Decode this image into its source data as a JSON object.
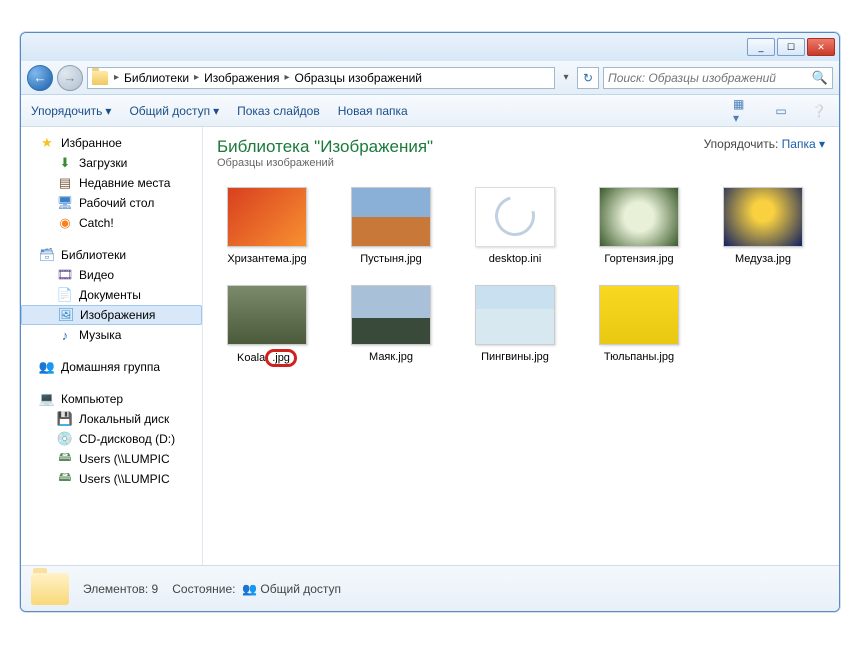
{
  "window": {
    "minimize": "_",
    "maximize": "☐",
    "close": "✕"
  },
  "breadcrumb": {
    "items": [
      "Библиотеки",
      "Изображения",
      "Образцы изображений"
    ]
  },
  "search": {
    "placeholder": "Поиск: Образцы изображений"
  },
  "toolbar": {
    "organize": "Упорядочить",
    "share": "Общий доступ",
    "slideshow": "Показ слайдов",
    "newfolder": "Новая папка"
  },
  "sidebar": {
    "favorites": {
      "label": "Избранное",
      "items": [
        "Загрузки",
        "Недавние места",
        "Рабочий стол",
        "Catch!"
      ]
    },
    "libraries": {
      "label": "Библиотеки",
      "items": [
        "Видео",
        "Документы",
        "Изображения",
        "Музыка"
      ]
    },
    "homegroup": {
      "label": "Домашняя группа"
    },
    "computer": {
      "label": "Компьютер",
      "items": [
        "Локальный диск",
        "CD-дисковод (D:)",
        "Users (\\\\LUMPIC",
        "Users (\\\\LUMPIC"
      ]
    }
  },
  "library_header": {
    "title": "Библиотека \"Изображения\"",
    "subtitle": "Образцы изображений",
    "arrange_label": "Упорядочить:",
    "arrange_value": "Папка"
  },
  "files": [
    {
      "name": "Хризантема.jpg",
      "thumb_bg": "linear-gradient(135deg,#d84020,#f89030)"
    },
    {
      "name": "Пустыня.jpg",
      "thumb_bg": "linear-gradient(#8ab0d8 50%,#c87838 50%)"
    },
    {
      "name": "desktop.ini",
      "thumb_bg": "#fff",
      "is_ini": true
    },
    {
      "name": "Гортензия.jpg",
      "thumb_bg": "radial-gradient(circle,#e8f0d8 30%,#3a5a2a)"
    },
    {
      "name": "Медуза.jpg",
      "thumb_bg": "radial-gradient(circle at 50% 40%,#f8d040 20%,#102060)"
    },
    {
      "name": "Koala.jpg",
      "thumb_bg": "linear-gradient(#7a8a6a,#4a5a3a)",
      "highlight_ext": true,
      "name_base": "Koala",
      "name_ext": ".jpg"
    },
    {
      "name": "Маяк.jpg",
      "thumb_bg": "linear-gradient(#a8c0d8 55%,#3a4a3a 55%)"
    },
    {
      "name": "Пингвины.jpg",
      "thumb_bg": "linear-gradient(#c8e0f0 40%,#d8e8f0 40%)"
    },
    {
      "name": "Тюльпаны.jpg",
      "thumb_bg": "linear-gradient(#f8d820,#e8c810)"
    }
  ],
  "statusbar": {
    "count_label": "Элементов:",
    "count_value": "9",
    "state_label": "Состояние:",
    "state_value": "Общий доступ"
  }
}
